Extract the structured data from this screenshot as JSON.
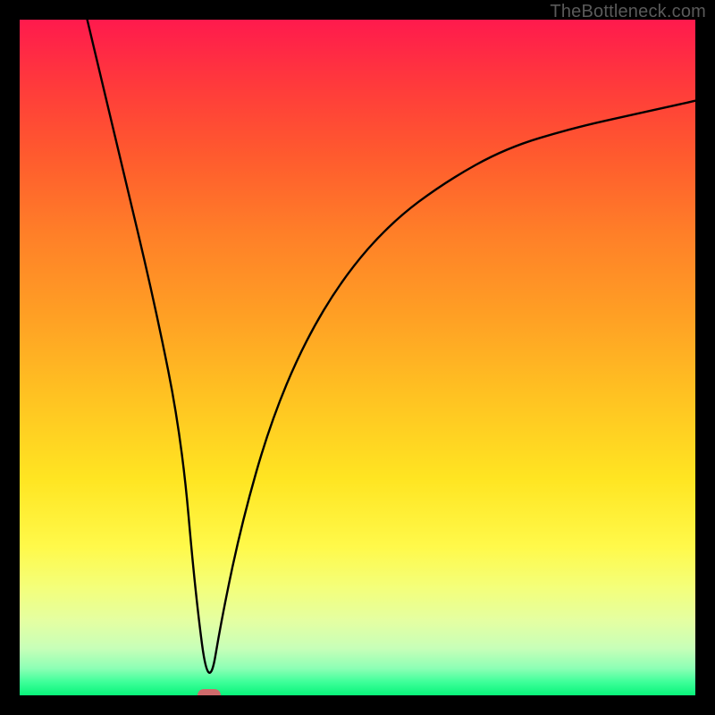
{
  "watermark": "TheBottleneck.com",
  "chart_data": {
    "type": "line",
    "title": "",
    "xlabel": "",
    "ylabel": "",
    "xlim": [
      0,
      100
    ],
    "ylim": [
      0,
      100
    ],
    "gradient_axis": "y",
    "gradient": {
      "top": "#ff1a4d",
      "bottom": "#08f47a",
      "description": "red-orange-yellow-green vertical gradient"
    },
    "curve": {
      "description": "V-shaped bottleneck curve; near-straight left branch, concave right branch rising toward ~88% at x=100",
      "points_x": [
        10,
        15,
        20,
        24,
        26,
        28,
        30,
        33,
        37,
        42,
        48,
        55,
        63,
        72,
        82,
        91,
        100
      ],
      "points_y": [
        100,
        79,
        58,
        38,
        15,
        0,
        12,
        26,
        40,
        52,
        62,
        70,
        76,
        81,
        84,
        86,
        88
      ]
    },
    "min_marker": {
      "x": 28,
      "y": 0,
      "color": "#cf6a6b"
    }
  }
}
